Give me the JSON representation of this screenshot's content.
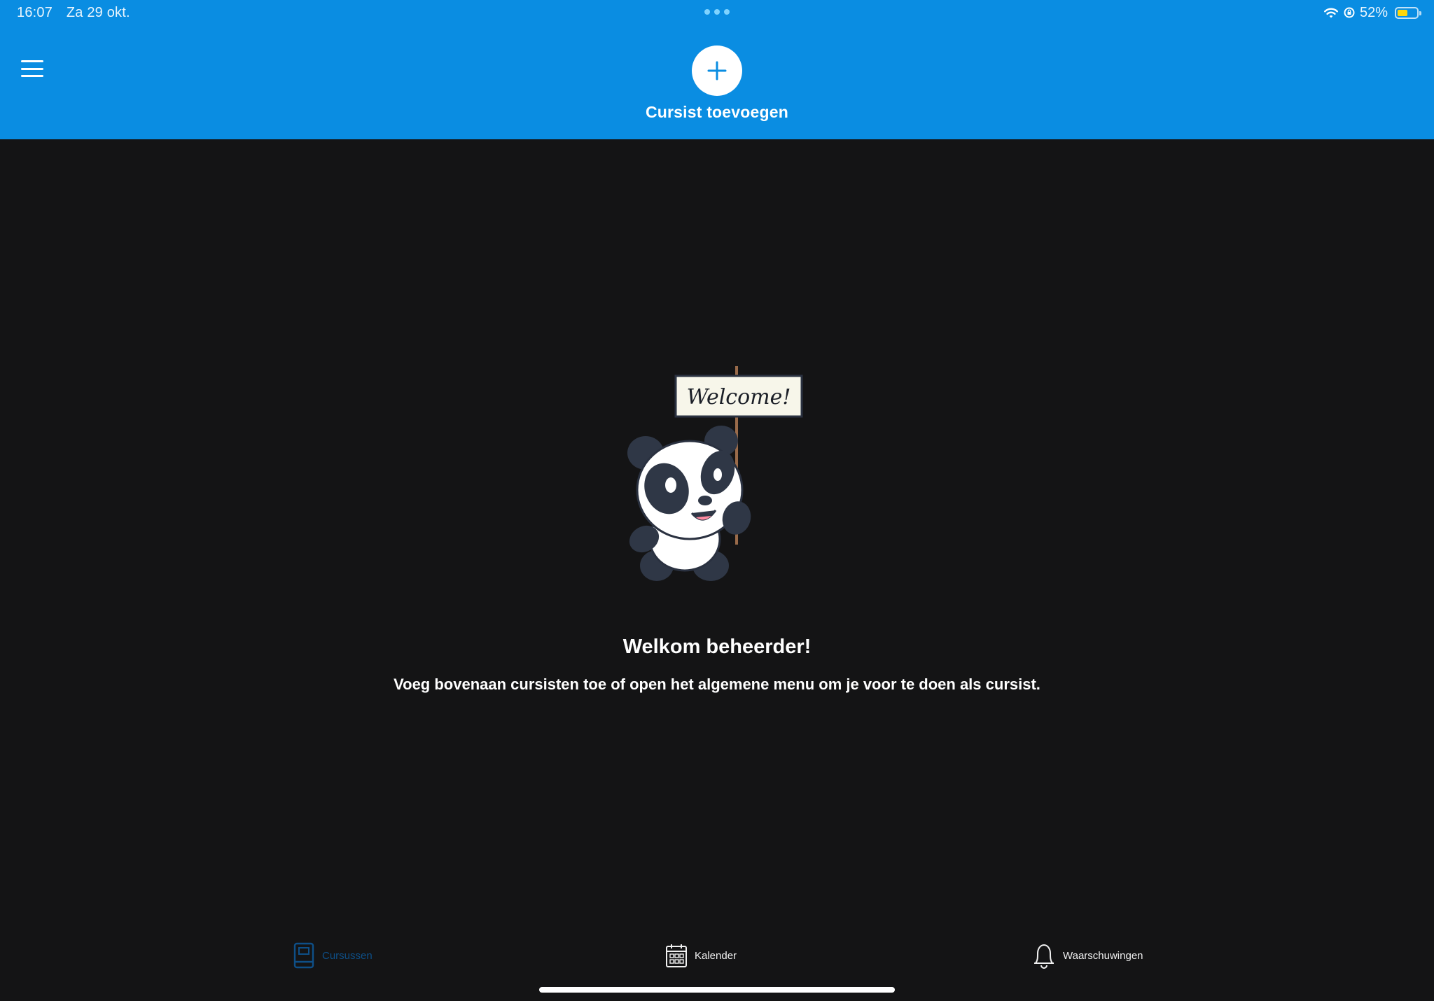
{
  "status_bar": {
    "time": "16:07",
    "date": "Za 29 okt.",
    "battery_percent": "52%",
    "battery_level": 0.52
  },
  "header": {
    "add_label": "Cursist toevoegen",
    "background_color": "#0a8de2"
  },
  "illustration": {
    "sign_text": "Welcome!"
  },
  "main": {
    "title": "Welkom beheerder!",
    "message": "Voeg bovenaan cursisten toe of open het algemene menu om je voor te doen als cursist."
  },
  "tabs": [
    {
      "label": "Cursussen",
      "icon": "book-icon",
      "active": true
    },
    {
      "label": "Kalender",
      "icon": "calendar-icon",
      "active": false
    },
    {
      "label": "Waarschuwingen",
      "icon": "bell-icon",
      "active": false
    }
  ],
  "colors": {
    "accent": "#0a8de2",
    "background": "#141415",
    "active_tab": "#0e4f87"
  }
}
